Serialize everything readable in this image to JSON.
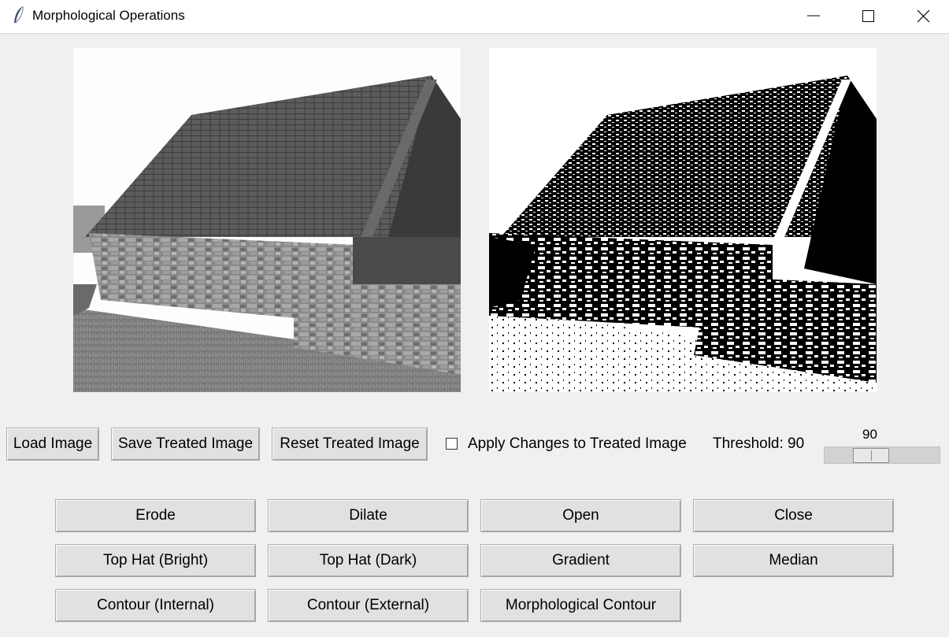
{
  "window": {
    "title": "Morphological Operations",
    "icon": "feather-icon",
    "controls": [
      "minimize-icon",
      "maximize-icon",
      "close-icon"
    ]
  },
  "images": {
    "original": "grayscale photo of stone barn",
    "treated": "binary thresholded photo of stone barn"
  },
  "toolbar": {
    "load_label": "Load Image",
    "save_label": "Save Treated Image",
    "reset_label": "Reset Treated Image",
    "apply_label": "Apply Changes to Treated Image",
    "apply_checked": false,
    "threshold_label": "Threshold: 90",
    "threshold_value": "90",
    "threshold_fraction": 0.35
  },
  "operations": {
    "erode": "Erode",
    "dilate": "Dilate",
    "open": "Open",
    "close": "Close",
    "tophat_bright": "Top Hat (Bright)",
    "tophat_dark": "Top Hat (Dark)",
    "gradient": "Gradient",
    "median": "Median",
    "contour_internal": "Contour (Internal)",
    "contour_external": "Contour (External)",
    "morph_contour": "Morphological Contour"
  }
}
